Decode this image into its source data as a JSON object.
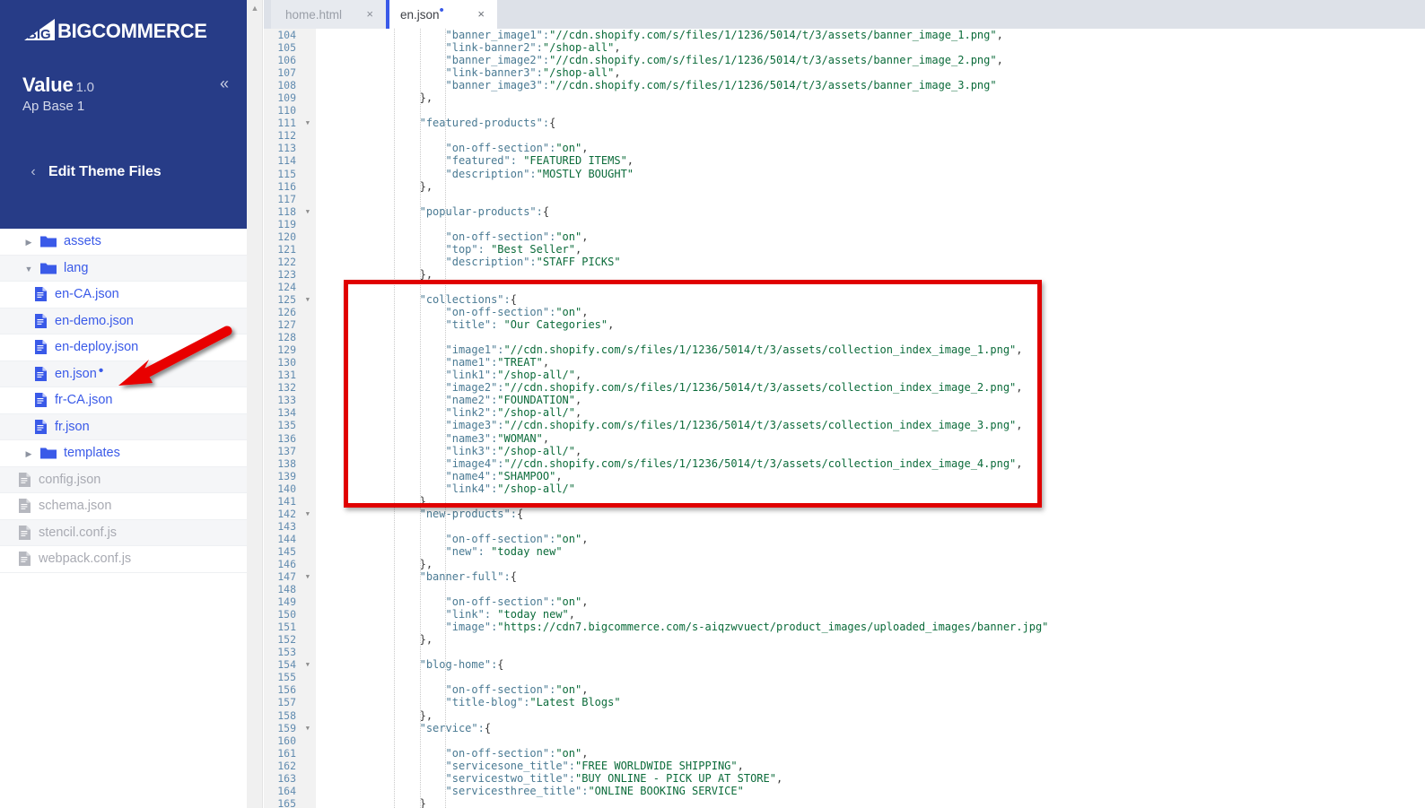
{
  "sidebar": {
    "brand": {
      "name": "BIGCOMMERCE",
      "icon": "bigcommerce-logo-icon"
    },
    "theme_title": "Value",
    "theme_version": "1.0",
    "theme_variant": "Ap Base 1",
    "collapse_icon": "«",
    "back_icon": "‹",
    "section_label": "Edit Theme Files",
    "tree": [
      {
        "label": "assets",
        "type": "folder",
        "state": "collapsed",
        "indent": 1,
        "muted": false,
        "modified": false
      },
      {
        "label": "lang",
        "type": "folder",
        "state": "expanded",
        "indent": 1,
        "muted": false,
        "modified": false
      },
      {
        "label": "en-CA.json",
        "type": "file",
        "state": "",
        "indent": 2,
        "muted": false,
        "modified": false
      },
      {
        "label": "en-demo.json",
        "type": "file",
        "state": "",
        "indent": 2,
        "muted": false,
        "modified": false
      },
      {
        "label": "en-deploy.json",
        "type": "file",
        "state": "",
        "indent": 2,
        "muted": false,
        "modified": false
      },
      {
        "label": "en.json",
        "type": "file",
        "state": "",
        "indent": 2,
        "muted": false,
        "modified": true
      },
      {
        "label": "fr-CA.json",
        "type": "file",
        "state": "",
        "indent": 2,
        "muted": false,
        "modified": false
      },
      {
        "label": "fr.json",
        "type": "file",
        "state": "",
        "indent": 2,
        "muted": false,
        "modified": false
      },
      {
        "label": "templates",
        "type": "folder",
        "state": "collapsed",
        "indent": 1,
        "muted": false,
        "modified": false
      },
      {
        "label": "config.json",
        "type": "file",
        "state": "",
        "indent": 1,
        "muted": true,
        "modified": false
      },
      {
        "label": "schema.json",
        "type": "file",
        "state": "",
        "indent": 1,
        "muted": true,
        "modified": false
      },
      {
        "label": "stencil.conf.js",
        "type": "file",
        "state": "",
        "indent": 1,
        "muted": true,
        "modified": false
      },
      {
        "label": "webpack.conf.js",
        "type": "file",
        "state": "",
        "indent": 1,
        "muted": true,
        "modified": false
      }
    ]
  },
  "scrollbar": {
    "up_icon": "▲"
  },
  "tabs": [
    {
      "label": "home.html",
      "active": false,
      "modified": false,
      "close_icon": "×"
    },
    {
      "label": "en.json",
      "active": true,
      "modified": true,
      "close_icon": "×"
    }
  ],
  "colors": {
    "brand_navy": "#273c87",
    "accent_blue": "#3a5ae8",
    "json_key": "#4a7a93",
    "json_value": "#0b6b3a",
    "highlight_red": "#e00000",
    "gutter_bg": "#f2f2f2"
  },
  "annotations": {
    "highlight_box": {
      "name": "collections-block-highlight",
      "color": "#e00000",
      "lines": "125-141"
    },
    "arrow": {
      "name": "pointer-arrow-to-en-json",
      "color": "#e00000",
      "points_to": "en.json"
    }
  },
  "editor": {
    "first_line_number": 104,
    "fold_lines": [
      111,
      118,
      125,
      142,
      147,
      154,
      159
    ],
    "code_lines": [
      {
        "n": 104,
        "indent": 8,
        "key": "\"banner_image1\"",
        "sep": ":",
        "value": "\"//cdn.shopify.com/s/files/1/1236/5014/t/3/assets/banner_image_1.png\"",
        "tail": ","
      },
      {
        "n": 105,
        "indent": 8,
        "key": "\"link-banner2\"",
        "sep": ":",
        "value": "\"/shop-all\"",
        "tail": ","
      },
      {
        "n": 106,
        "indent": 8,
        "key": "\"banner_image2\"",
        "sep": ":",
        "value": "\"//cdn.shopify.com/s/files/1/1236/5014/t/3/assets/banner_image_2.png\"",
        "tail": ","
      },
      {
        "n": 107,
        "indent": 8,
        "key": "\"link-banner3\"",
        "sep": ":",
        "value": "\"/shop-all\"",
        "tail": ","
      },
      {
        "n": 108,
        "indent": 8,
        "key": "\"banner_image3\"",
        "sep": ":",
        "value": "\"//cdn.shopify.com/s/files/1/1236/5014/t/3/assets/banner_image_3.png\"",
        "tail": ""
      },
      {
        "n": 109,
        "indent": 4,
        "key": "",
        "sep": "",
        "value": "",
        "tail": "},"
      },
      {
        "n": 110,
        "indent": 0,
        "key": "",
        "sep": "",
        "value": "",
        "tail": ""
      },
      {
        "n": 111,
        "indent": 4,
        "key": "\"featured-products\"",
        "sep": ":",
        "value": "",
        "tail": "{"
      },
      {
        "n": 112,
        "indent": 0,
        "key": "",
        "sep": "",
        "value": "",
        "tail": ""
      },
      {
        "n": 113,
        "indent": 8,
        "key": "\"on-off-section\"",
        "sep": ":",
        "value": "\"on\"",
        "tail": ","
      },
      {
        "n": 114,
        "indent": 8,
        "key": "\"featured\"",
        "sep": ": ",
        "value": "\"FEATURED ITEMS\"",
        "tail": ","
      },
      {
        "n": 115,
        "indent": 8,
        "key": "\"description\"",
        "sep": ":",
        "value": "\"MOSTLY BOUGHT\"",
        "tail": ""
      },
      {
        "n": 116,
        "indent": 4,
        "key": "",
        "sep": "",
        "value": "",
        "tail": "},"
      },
      {
        "n": 117,
        "indent": 0,
        "key": "",
        "sep": "",
        "value": "",
        "tail": ""
      },
      {
        "n": 118,
        "indent": 4,
        "key": "\"popular-products\"",
        "sep": ":",
        "value": "",
        "tail": "{"
      },
      {
        "n": 119,
        "indent": 0,
        "key": "",
        "sep": "",
        "value": "",
        "tail": ""
      },
      {
        "n": 120,
        "indent": 8,
        "key": "\"on-off-section\"",
        "sep": ":",
        "value": "\"on\"",
        "tail": ","
      },
      {
        "n": 121,
        "indent": 8,
        "key": "\"top\"",
        "sep": ": ",
        "value": "\"Best Seller\"",
        "tail": ","
      },
      {
        "n": 122,
        "indent": 8,
        "key": "\"description\"",
        "sep": ":",
        "value": "\"STAFF PICKS\"",
        "tail": ""
      },
      {
        "n": 123,
        "indent": 4,
        "key": "",
        "sep": "",
        "value": "",
        "tail": "},"
      },
      {
        "n": 124,
        "indent": 0,
        "key": "",
        "sep": "",
        "value": "",
        "tail": ""
      },
      {
        "n": 125,
        "indent": 4,
        "key": "\"collections\"",
        "sep": ":",
        "value": "",
        "tail": "{"
      },
      {
        "n": 126,
        "indent": 8,
        "key": "\"on-off-section\"",
        "sep": ":",
        "value": "\"on\"",
        "tail": ","
      },
      {
        "n": 127,
        "indent": 8,
        "key": "\"title\"",
        "sep": ": ",
        "value": "\"Our Categories\"",
        "tail": ","
      },
      {
        "n": 128,
        "indent": 0,
        "key": "",
        "sep": "",
        "value": "",
        "tail": ""
      },
      {
        "n": 129,
        "indent": 8,
        "key": "\"image1\"",
        "sep": ":",
        "value": "\"//cdn.shopify.com/s/files/1/1236/5014/t/3/assets/collection_index_image_1.png\"",
        "tail": ","
      },
      {
        "n": 130,
        "indent": 8,
        "key": "\"name1\"",
        "sep": ":",
        "value": "\"TREAT\"",
        "tail": ","
      },
      {
        "n": 131,
        "indent": 8,
        "key": "\"link1\"",
        "sep": ":",
        "value": "\"/shop-all/\"",
        "tail": ","
      },
      {
        "n": 132,
        "indent": 8,
        "key": "\"image2\"",
        "sep": ":",
        "value": "\"//cdn.shopify.com/s/files/1/1236/5014/t/3/assets/collection_index_image_2.png\"",
        "tail": ","
      },
      {
        "n": 133,
        "indent": 8,
        "key": "\"name2\"",
        "sep": ":",
        "value": "\"FOUNDATION\"",
        "tail": ","
      },
      {
        "n": 134,
        "indent": 8,
        "key": "\"link2\"",
        "sep": ":",
        "value": "\"/shop-all/\"",
        "tail": ","
      },
      {
        "n": 135,
        "indent": 8,
        "key": "\"image3\"",
        "sep": ":",
        "value": "\"//cdn.shopify.com/s/files/1/1236/5014/t/3/assets/collection_index_image_3.png\"",
        "tail": ","
      },
      {
        "n": 136,
        "indent": 8,
        "key": "\"name3\"",
        "sep": ":",
        "value": "\"WOMAN\"",
        "tail": ","
      },
      {
        "n": 137,
        "indent": 8,
        "key": "\"link3\"",
        "sep": ":",
        "value": "\"/shop-all/\"",
        "tail": ","
      },
      {
        "n": 138,
        "indent": 8,
        "key": "\"image4\"",
        "sep": ":",
        "value": "\"//cdn.shopify.com/s/files/1/1236/5014/t/3/assets/collection_index_image_4.png\"",
        "tail": ","
      },
      {
        "n": 139,
        "indent": 8,
        "key": "\"name4\"",
        "sep": ":",
        "value": "\"SHAMPOO\"",
        "tail": ","
      },
      {
        "n": 140,
        "indent": 8,
        "key": "\"link4\"",
        "sep": ":",
        "value": "\"/shop-all/\"",
        "tail": ""
      },
      {
        "n": 141,
        "indent": 4,
        "key": "",
        "sep": "",
        "value": "",
        "tail": "},"
      },
      {
        "n": 142,
        "indent": 4,
        "key": "\"new-products\"",
        "sep": ":",
        "value": "",
        "tail": "{"
      },
      {
        "n": 143,
        "indent": 0,
        "key": "",
        "sep": "",
        "value": "",
        "tail": ""
      },
      {
        "n": 144,
        "indent": 8,
        "key": "\"on-off-section\"",
        "sep": ":",
        "value": "\"on\"",
        "tail": ","
      },
      {
        "n": 145,
        "indent": 8,
        "key": "\"new\"",
        "sep": ": ",
        "value": "\"today new\"",
        "tail": ""
      },
      {
        "n": 146,
        "indent": 4,
        "key": "",
        "sep": "",
        "value": "",
        "tail": "},"
      },
      {
        "n": 147,
        "indent": 4,
        "key": "\"banner-full\"",
        "sep": ":",
        "value": "",
        "tail": "{"
      },
      {
        "n": 148,
        "indent": 0,
        "key": "",
        "sep": "",
        "value": "",
        "tail": ""
      },
      {
        "n": 149,
        "indent": 8,
        "key": "\"on-off-section\"",
        "sep": ":",
        "value": "\"on\"",
        "tail": ","
      },
      {
        "n": 150,
        "indent": 8,
        "key": "\"link\"",
        "sep": ": ",
        "value": "\"today new\"",
        "tail": ","
      },
      {
        "n": 151,
        "indent": 8,
        "key": "\"image\"",
        "sep": ":",
        "value": "\"https://cdn7.bigcommerce.com/s-aiqzwvuect/product_images/uploaded_images/banner.jpg\"",
        "tail": ""
      },
      {
        "n": 152,
        "indent": 4,
        "key": "",
        "sep": "",
        "value": "",
        "tail": "},"
      },
      {
        "n": 153,
        "indent": 0,
        "key": "",
        "sep": "",
        "value": "",
        "tail": ""
      },
      {
        "n": 154,
        "indent": 4,
        "key": "\"blog-home\"",
        "sep": ":",
        "value": "",
        "tail": "{"
      },
      {
        "n": 155,
        "indent": 0,
        "key": "",
        "sep": "",
        "value": "",
        "tail": ""
      },
      {
        "n": 156,
        "indent": 8,
        "key": "\"on-off-section\"",
        "sep": ":",
        "value": "\"on\"",
        "tail": ","
      },
      {
        "n": 157,
        "indent": 8,
        "key": "\"title-blog\"",
        "sep": ":",
        "value": "\"Latest Blogs\"",
        "tail": ""
      },
      {
        "n": 158,
        "indent": 4,
        "key": "",
        "sep": "",
        "value": "",
        "tail": "},"
      },
      {
        "n": 159,
        "indent": 4,
        "key": "\"service\"",
        "sep": ":",
        "value": "",
        "tail": "{"
      },
      {
        "n": 160,
        "indent": 0,
        "key": "",
        "sep": "",
        "value": "",
        "tail": ""
      },
      {
        "n": 161,
        "indent": 8,
        "key": "\"on-off-section\"",
        "sep": ":",
        "value": "\"on\"",
        "tail": ","
      },
      {
        "n": 162,
        "indent": 8,
        "key": "\"servicesone_title\"",
        "sep": ":",
        "value": "\"FREE WORLDWIDE SHIPPING\"",
        "tail": ","
      },
      {
        "n": 163,
        "indent": 8,
        "key": "\"servicestwo_title\"",
        "sep": ":",
        "value": "\"BUY ONLINE - PICK UP AT STORE\"",
        "tail": ","
      },
      {
        "n": 164,
        "indent": 8,
        "key": "\"servicesthree_title\"",
        "sep": ":",
        "value": "\"ONLINE BOOKING SERVICE\"",
        "tail": ""
      },
      {
        "n": 165,
        "indent": 4,
        "key": "",
        "sep": "",
        "value": "",
        "tail": "}"
      }
    ]
  }
}
